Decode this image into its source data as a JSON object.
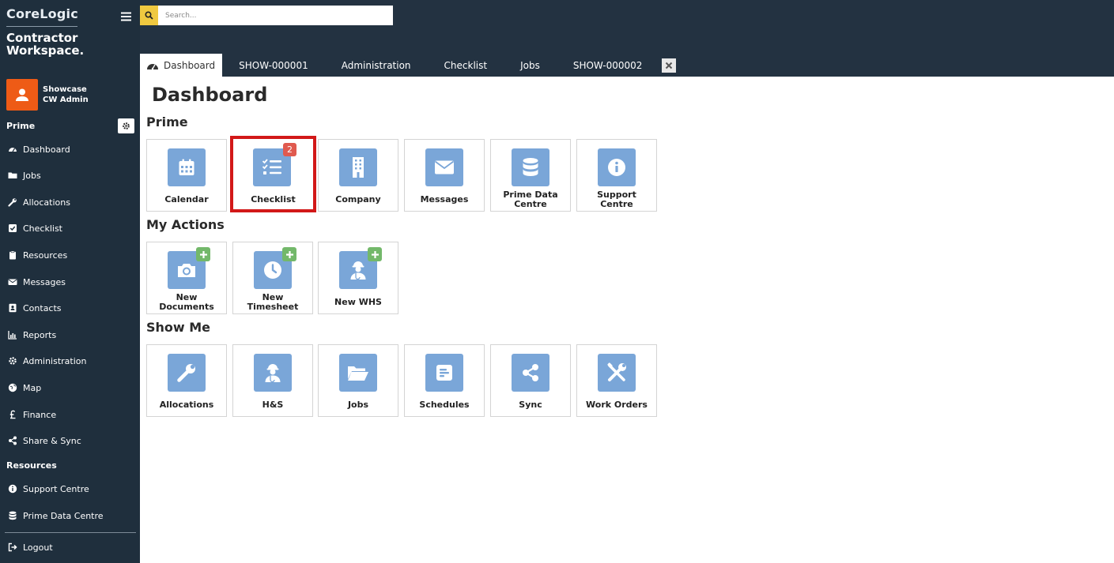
{
  "brand": {
    "company": "CoreLogic",
    "product_line1": "Contractor",
    "product_line2": "Workspace."
  },
  "user": {
    "name": "Showcase",
    "role": "CW Admin"
  },
  "sidebar": {
    "section_prime": "Prime",
    "section_resources": "Resources",
    "items": [
      {
        "label": "Dashboard",
        "icon": "dashboard-icon"
      },
      {
        "label": "Jobs",
        "icon": "folder-icon"
      },
      {
        "label": "Allocations",
        "icon": "wrench-icon"
      },
      {
        "label": "Checklist",
        "icon": "checkbox-icon"
      },
      {
        "label": "Resources",
        "icon": "clipboard-icon"
      },
      {
        "label": "Messages",
        "icon": "envelope-icon"
      },
      {
        "label": "Contacts",
        "icon": "contact-card-icon"
      },
      {
        "label": "Reports",
        "icon": "bar-chart-icon"
      },
      {
        "label": "Administration",
        "icon": "gear-icon"
      },
      {
        "label": "Map",
        "icon": "globe-icon"
      },
      {
        "label": "Finance",
        "icon": "pound-icon"
      },
      {
        "label": "Share & Sync",
        "icon": "share-icon"
      }
    ],
    "resource_items": [
      {
        "label": "Support Centre",
        "icon": "info-icon"
      },
      {
        "label": "Prime Data Centre",
        "icon": "database-icon"
      }
    ],
    "logout": "Logout"
  },
  "search": {
    "placeholder": "Search..."
  },
  "tabs": [
    "Dashboard",
    "SHOW-000001",
    "Administration",
    "Checklist",
    "Jobs",
    "SHOW-000002"
  ],
  "page": {
    "title": "Dashboard"
  },
  "groups": {
    "prime": {
      "title": "Prime",
      "tiles": [
        {
          "label": "Calendar",
          "icon": "calendar-icon"
        },
        {
          "label": "Checklist",
          "icon": "checklist-icon",
          "badge": "2"
        },
        {
          "label": "Company",
          "icon": "building-icon"
        },
        {
          "label": "Messages",
          "icon": "envelope-icon"
        },
        {
          "label": "Prime Data Centre",
          "icon": "database-icon"
        },
        {
          "label": "Support Centre",
          "icon": "info-icon"
        }
      ]
    },
    "actions": {
      "title": "My Actions",
      "tiles": [
        {
          "label": "New Documents",
          "icon": "camera-icon"
        },
        {
          "label": "New Timesheet",
          "icon": "clock-icon"
        },
        {
          "label": "New WHS",
          "icon": "worker-icon"
        }
      ]
    },
    "show": {
      "title": "Show Me",
      "tiles": [
        {
          "label": "Allocations",
          "icon": "wrench-icon"
        },
        {
          "label": "H&S",
          "icon": "worker-icon"
        },
        {
          "label": "Jobs",
          "icon": "folder-open-icon"
        },
        {
          "label": "Schedules",
          "icon": "schedule-icon"
        },
        {
          "label": "Sync",
          "icon": "share-icon"
        },
        {
          "label": "Work Orders",
          "icon": "tools-icon"
        }
      ]
    }
  },
  "colors": {
    "sidebar": "#1f2f3d",
    "topbar": "#233241",
    "tile_icon": "#7aa6d8",
    "badge": "#e05a4f",
    "plus": "#73b86a",
    "highlight": "#d21818",
    "avatar": "#ee5b16",
    "search_button": "#f0c940"
  }
}
